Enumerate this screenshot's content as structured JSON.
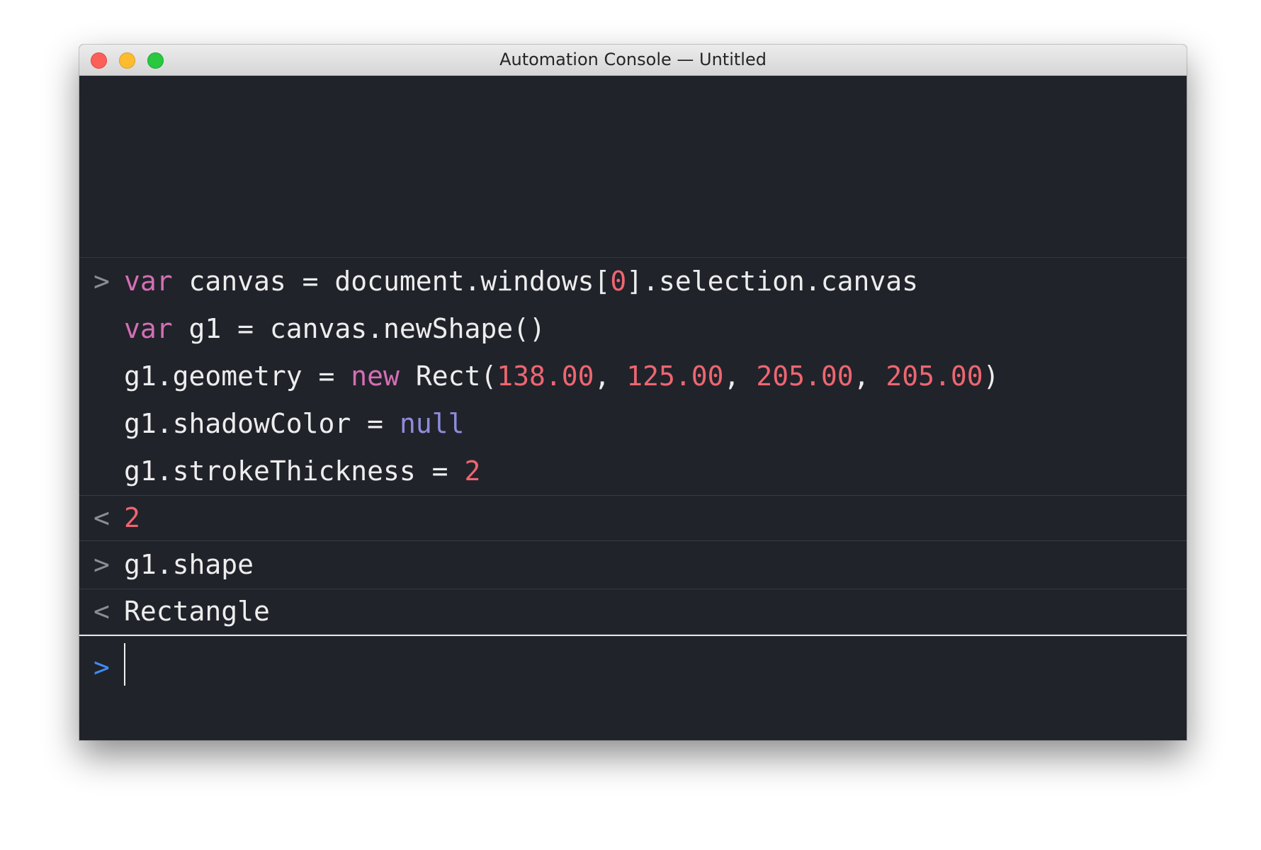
{
  "window": {
    "title": "Automation Console — Untitled"
  },
  "colors": {
    "background": "#21232b",
    "keyword": "#d56fb4",
    "number": "#ee6670",
    "null": "#8f8cdc",
    "prompt_active": "#3f8cf2"
  },
  "icons": {
    "close": "close-dot-icon",
    "minimize": "minimize-dot-icon",
    "zoom": "zoom-dot-icon",
    "input_prompt": "chevron-right-icon",
    "output_prompt": "chevron-left-icon"
  },
  "console": {
    "input_prompt": ">",
    "output_prompt": "<",
    "entries": [
      {
        "type": "input",
        "lines": [
          {
            "tokens": [
              {
                "text": "var",
                "kind": "kw"
              },
              {
                "text": " canvas = document.windows[",
                "kind": "id"
              },
              {
                "text": "0",
                "kind": "num"
              },
              {
                "text": "].selection.canvas",
                "kind": "id"
              }
            ]
          },
          {
            "tokens": [
              {
                "text": "var",
                "kind": "kw"
              },
              {
                "text": " g1 = canvas.newShape()",
                "kind": "id"
              }
            ]
          },
          {
            "tokens": [
              {
                "text": "g1.geometry = ",
                "kind": "id"
              },
              {
                "text": "new",
                "kind": "kw"
              },
              {
                "text": " Rect(",
                "kind": "id"
              },
              {
                "text": "138.00",
                "kind": "num"
              },
              {
                "text": ", ",
                "kind": "id"
              },
              {
                "text": "125.00",
                "kind": "num"
              },
              {
                "text": ", ",
                "kind": "id"
              },
              {
                "text": "205.00",
                "kind": "num"
              },
              {
                "text": ", ",
                "kind": "id"
              },
              {
                "text": "205.00",
                "kind": "num"
              },
              {
                "text": ")",
                "kind": "id"
              }
            ]
          },
          {
            "tokens": [
              {
                "text": "g1.shadowColor = ",
                "kind": "id"
              },
              {
                "text": "null",
                "kind": "nul"
              }
            ]
          },
          {
            "tokens": [
              {
                "text": "g1.strokeThickness = ",
                "kind": "id"
              },
              {
                "text": "2",
                "kind": "num"
              }
            ]
          }
        ]
      },
      {
        "type": "output",
        "lines": [
          {
            "tokens": [
              {
                "text": "2",
                "kind": "num"
              }
            ]
          }
        ]
      },
      {
        "type": "input",
        "lines": [
          {
            "tokens": [
              {
                "text": "g1.shape",
                "kind": "id"
              }
            ]
          }
        ]
      },
      {
        "type": "output",
        "lines": [
          {
            "tokens": [
              {
                "text": "Rectangle",
                "kind": "id"
              }
            ]
          }
        ]
      }
    ],
    "current_input": ""
  }
}
